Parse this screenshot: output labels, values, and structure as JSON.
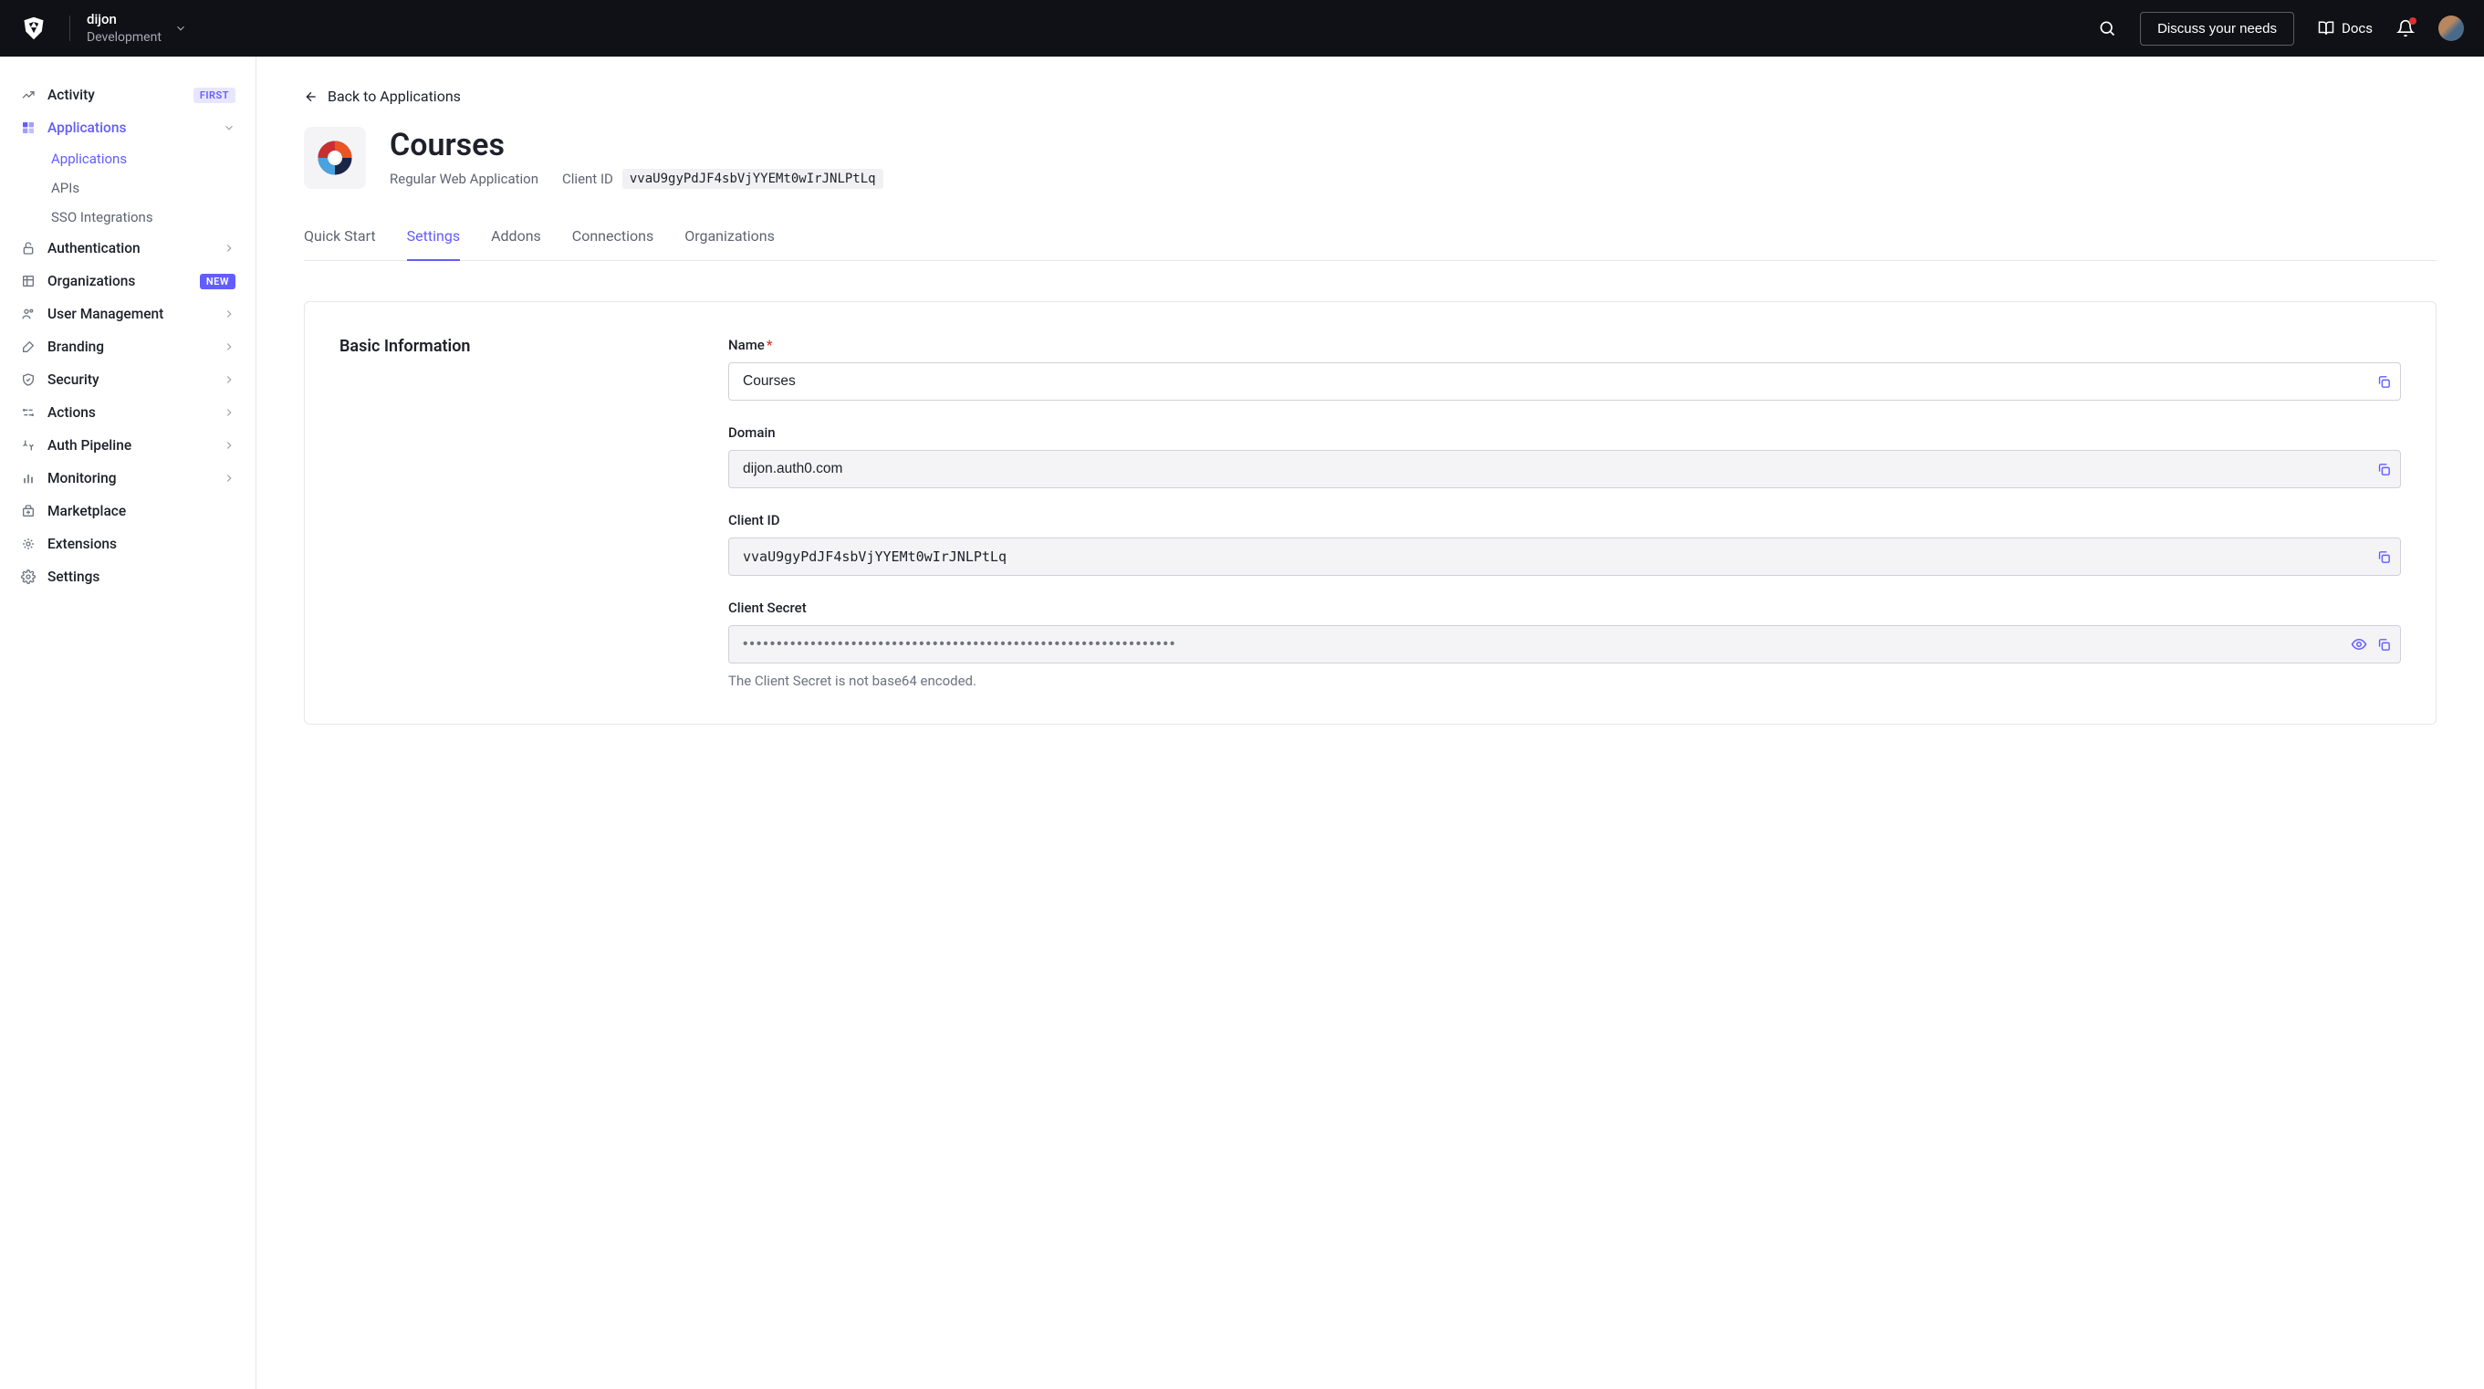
{
  "header": {
    "tenant_name": "dijon",
    "tenant_env": "Development",
    "discuss_button": "Discuss your needs",
    "docs_label": "Docs"
  },
  "sidebar": {
    "items": [
      {
        "label": "Activity",
        "badge": "FIRST",
        "icon": "activity"
      },
      {
        "label": "Applications",
        "icon": "applications",
        "active": true,
        "expanded": true,
        "children": [
          {
            "label": "Applications",
            "active": true
          },
          {
            "label": "APIs"
          },
          {
            "label": "SSO Integrations"
          }
        ]
      },
      {
        "label": "Authentication",
        "icon": "lock",
        "expandable": true
      },
      {
        "label": "Organizations",
        "icon": "org",
        "badge": "NEW"
      },
      {
        "label": "User Management",
        "icon": "users",
        "expandable": true
      },
      {
        "label": "Branding",
        "icon": "brush",
        "expandable": true
      },
      {
        "label": "Security",
        "icon": "shield",
        "expandable": true
      },
      {
        "label": "Actions",
        "icon": "actions",
        "expandable": true
      },
      {
        "label": "Auth Pipeline",
        "icon": "pipeline",
        "expandable": true
      },
      {
        "label": "Monitoring",
        "icon": "monitoring",
        "expandable": true
      },
      {
        "label": "Marketplace",
        "icon": "marketplace"
      },
      {
        "label": "Extensions",
        "icon": "extensions"
      },
      {
        "label": "Settings",
        "icon": "settings"
      }
    ]
  },
  "main": {
    "back_link": "Back to Applications",
    "title": "Courses",
    "app_type": "Regular Web Application",
    "client_id_label": "Client ID",
    "client_id_value": "vvaU9gyPdJF4sbVjYYEMt0wIrJNLPtLq",
    "tabs": [
      {
        "label": "Quick Start"
      },
      {
        "label": "Settings",
        "active": true
      },
      {
        "label": "Addons"
      },
      {
        "label": "Connections"
      },
      {
        "label": "Organizations"
      }
    ],
    "section_title": "Basic Information",
    "fields": {
      "name": {
        "label": "Name",
        "value": "Courses",
        "required": true
      },
      "domain": {
        "label": "Domain",
        "value": "dijon.auth0.com"
      },
      "client_id": {
        "label": "Client ID",
        "value": "vvaU9gyPdJF4sbVjYYEMt0wIrJNLPtLq"
      },
      "client_secret": {
        "label": "Client Secret",
        "value": "••••••••••••••••••••••••••••••••••••••••••••••••••••••••••••••••",
        "hint": "The Client Secret is not base64 encoded."
      }
    }
  }
}
